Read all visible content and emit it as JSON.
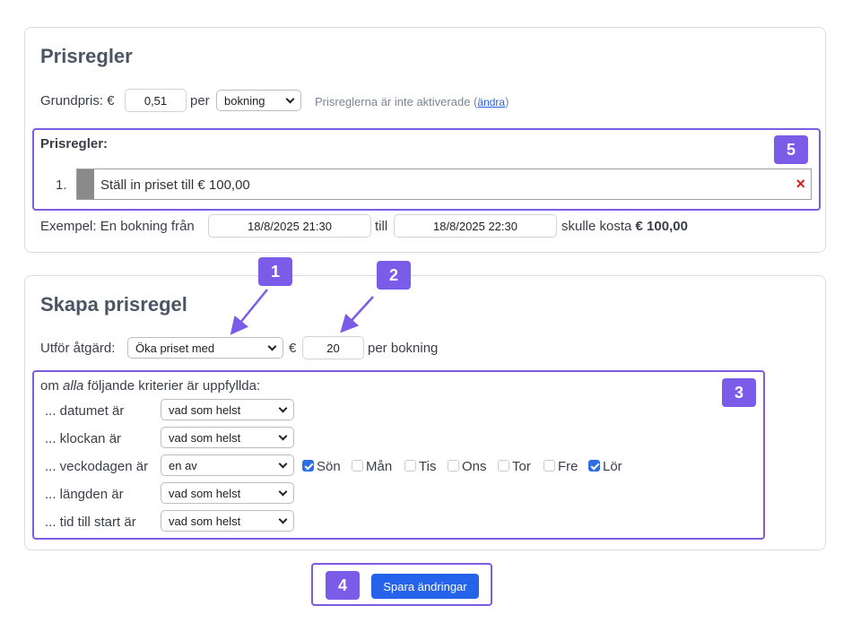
{
  "pricing": {
    "title": "Prisregler",
    "base_price_label": "Grundpris: €",
    "base_price_value": "0,51",
    "per_label": "per",
    "unit_select": "bokning",
    "inactive_text": "Prisreglerna är inte aktiverade",
    "change_link": "ändra",
    "paren_open": "(",
    "paren_close": ")",
    "rules_label": "Prisregler:",
    "rules": [
      {
        "index": "1.",
        "text": "Ställ in priset till € 100,00",
        "remove_icon": "×"
      }
    ],
    "example": {
      "prefix": "Exempel: En bokning från",
      "from": "18/8/2025 21:30",
      "to_label": "till",
      "to": "18/8/2025 22:30",
      "result_prefix": "skulle kosta",
      "result_value": "€ 100,00"
    }
  },
  "create_rule": {
    "title": "Skapa prisregel",
    "action_label": "Utför åtgärd:",
    "action_select": "Öka priset med",
    "currency": "€",
    "amount_value": "20",
    "per_booking": "per bokning",
    "criteria_intro_pre": "om ",
    "criteria_intro_em": "alla",
    "criteria_intro_post": " följande kriterier är uppfyllda:",
    "criteria": [
      {
        "label": "... datumet är",
        "select": "vad som helst"
      },
      {
        "label": "... klockan är",
        "select": "vad som helst"
      },
      {
        "label": "... veckodagen är",
        "select": "en av"
      },
      {
        "label": "... längden är",
        "select": "vad som helst"
      },
      {
        "label": "... tid till start är",
        "select": "vad som helst"
      }
    ],
    "weekdays": [
      {
        "label": "Sön",
        "checked": true
      },
      {
        "label": "Mån",
        "checked": false
      },
      {
        "label": "Tis",
        "checked": false
      },
      {
        "label": "Ons",
        "checked": false
      },
      {
        "label": "Tor",
        "checked": false
      },
      {
        "label": "Fre",
        "checked": false
      },
      {
        "label": "Lör",
        "checked": true
      }
    ]
  },
  "save_button": "Spara ändringar",
  "callouts": [
    "1",
    "2",
    "3",
    "4",
    "5"
  ],
  "colors": {
    "accent": "#7b5ce8",
    "primary": "#2563eb",
    "remove": "#d21f1f"
  }
}
